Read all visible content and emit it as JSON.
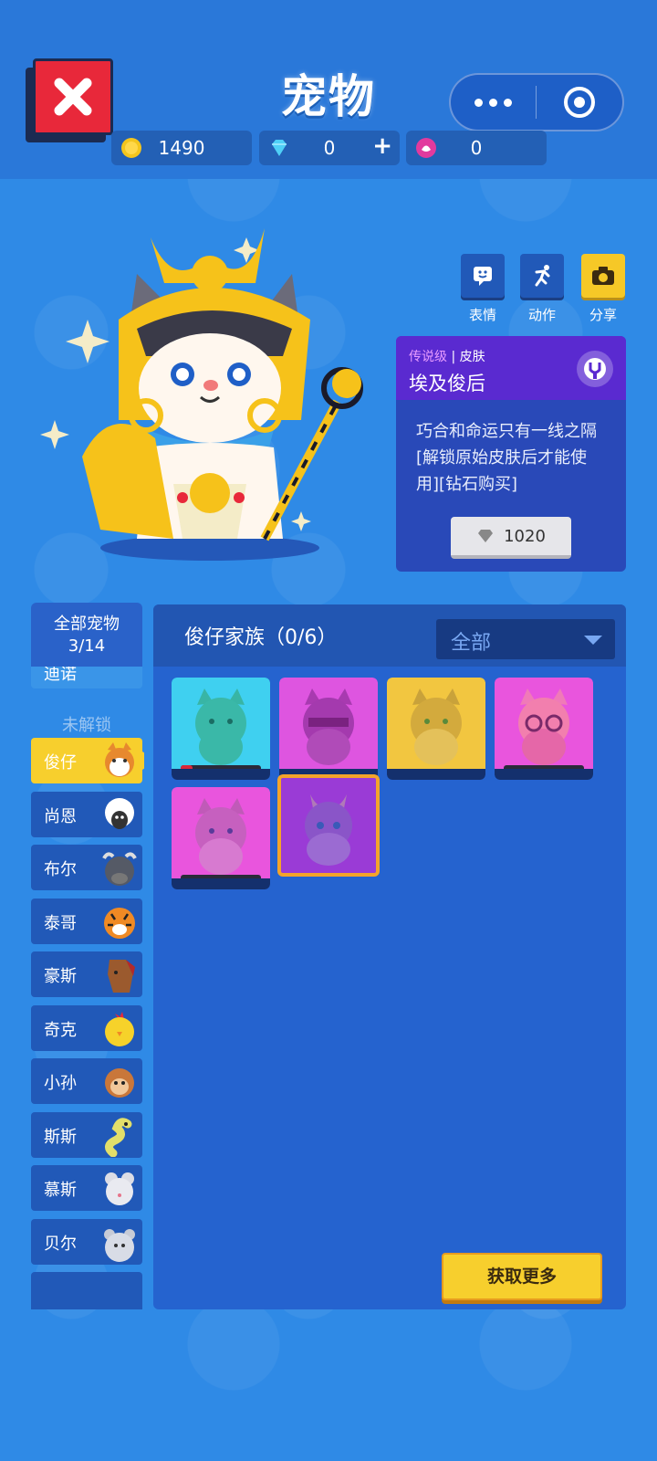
{
  "header": {
    "title": "宠物",
    "close_icon": "close-x-icon",
    "capsule": {
      "more_icon": "more-dots-icon",
      "target_icon": "target-icon"
    }
  },
  "currencies": [
    {
      "icon": "gold-coin-icon",
      "value": "1490",
      "color": "#f4c51d"
    },
    {
      "icon": "diamond-icon",
      "value": "0",
      "plus": "+",
      "color": "#4fd0f7"
    },
    {
      "icon": "lotus-token-icon",
      "value": "0",
      "color": "#e23a9e"
    }
  ],
  "actions": [
    {
      "icon": "emoji-icon",
      "label": "表情"
    },
    {
      "icon": "action-icon",
      "label": "动作"
    },
    {
      "icon": "camera-icon",
      "label": "分享"
    }
  ],
  "skin_card": {
    "rarity": "传说级",
    "separator": " | ",
    "category": "皮肤",
    "name": "埃及俊后",
    "description": "巧合和命运只有一线之隔\n[解锁原始皮肤后才能使用][钻石购买]",
    "desc_line1": "巧合和命运只有一线之隔",
    "desc_line2": "[解锁原始皮肤后才能使用][钻石购买]",
    "price": "1020",
    "rarity_color": "#e89cff"
  },
  "left_list": {
    "header_line1": "全部宠物",
    "header_line2": "3/14",
    "partial_item": "迪诺",
    "locked_label": "未解锁",
    "items": [
      {
        "label": "俊仔",
        "active": true
      },
      {
        "label": "尚恩"
      },
      {
        "label": "布尔"
      },
      {
        "label": "泰哥"
      },
      {
        "label": "豪斯"
      },
      {
        "label": "奇克"
      },
      {
        "label": "小孙"
      },
      {
        "label": "斯斯"
      },
      {
        "label": "慕斯"
      },
      {
        "label": "贝尔"
      }
    ]
  },
  "panel": {
    "family_title": "俊仔家族（0/6）",
    "filter_value": "全部",
    "skins": [
      {
        "color": "#3fd0f0",
        "progress": 0.15
      },
      {
        "color": "#de55e0"
      },
      {
        "color": "#f2c640"
      },
      {
        "color": "#e955dd",
        "progress": 0
      },
      {
        "color": "#e955dd",
        "progress": 0
      },
      {
        "color": "#9a3bd6",
        "selected": true
      }
    ]
  },
  "get_more_label": "获取更多"
}
